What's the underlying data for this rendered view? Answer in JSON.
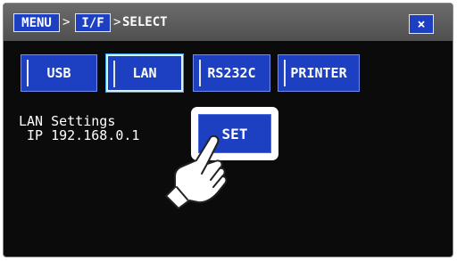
{
  "breadcrumb": {
    "menu": "MENU",
    "sep1": ">",
    "interface": "I/F",
    "sep2": ">",
    "current": "SELECT"
  },
  "close_label": "×",
  "tabs": [
    {
      "label": "USB",
      "active": false
    },
    {
      "label": "LAN",
      "active": true
    },
    {
      "label": "RS232C",
      "active": false
    },
    {
      "label": "PRINTER",
      "active": false
    }
  ],
  "info": {
    "line1": "LAN Settings",
    "line2": "IP 192.168.0.1"
  },
  "set_label": "SET",
  "colors": {
    "button_blue": "#1d3fc2",
    "titlebar": "#5a5a5a",
    "background": "#0b0b0b"
  },
  "icons": {
    "pointer": "pointing-hand-icon"
  }
}
